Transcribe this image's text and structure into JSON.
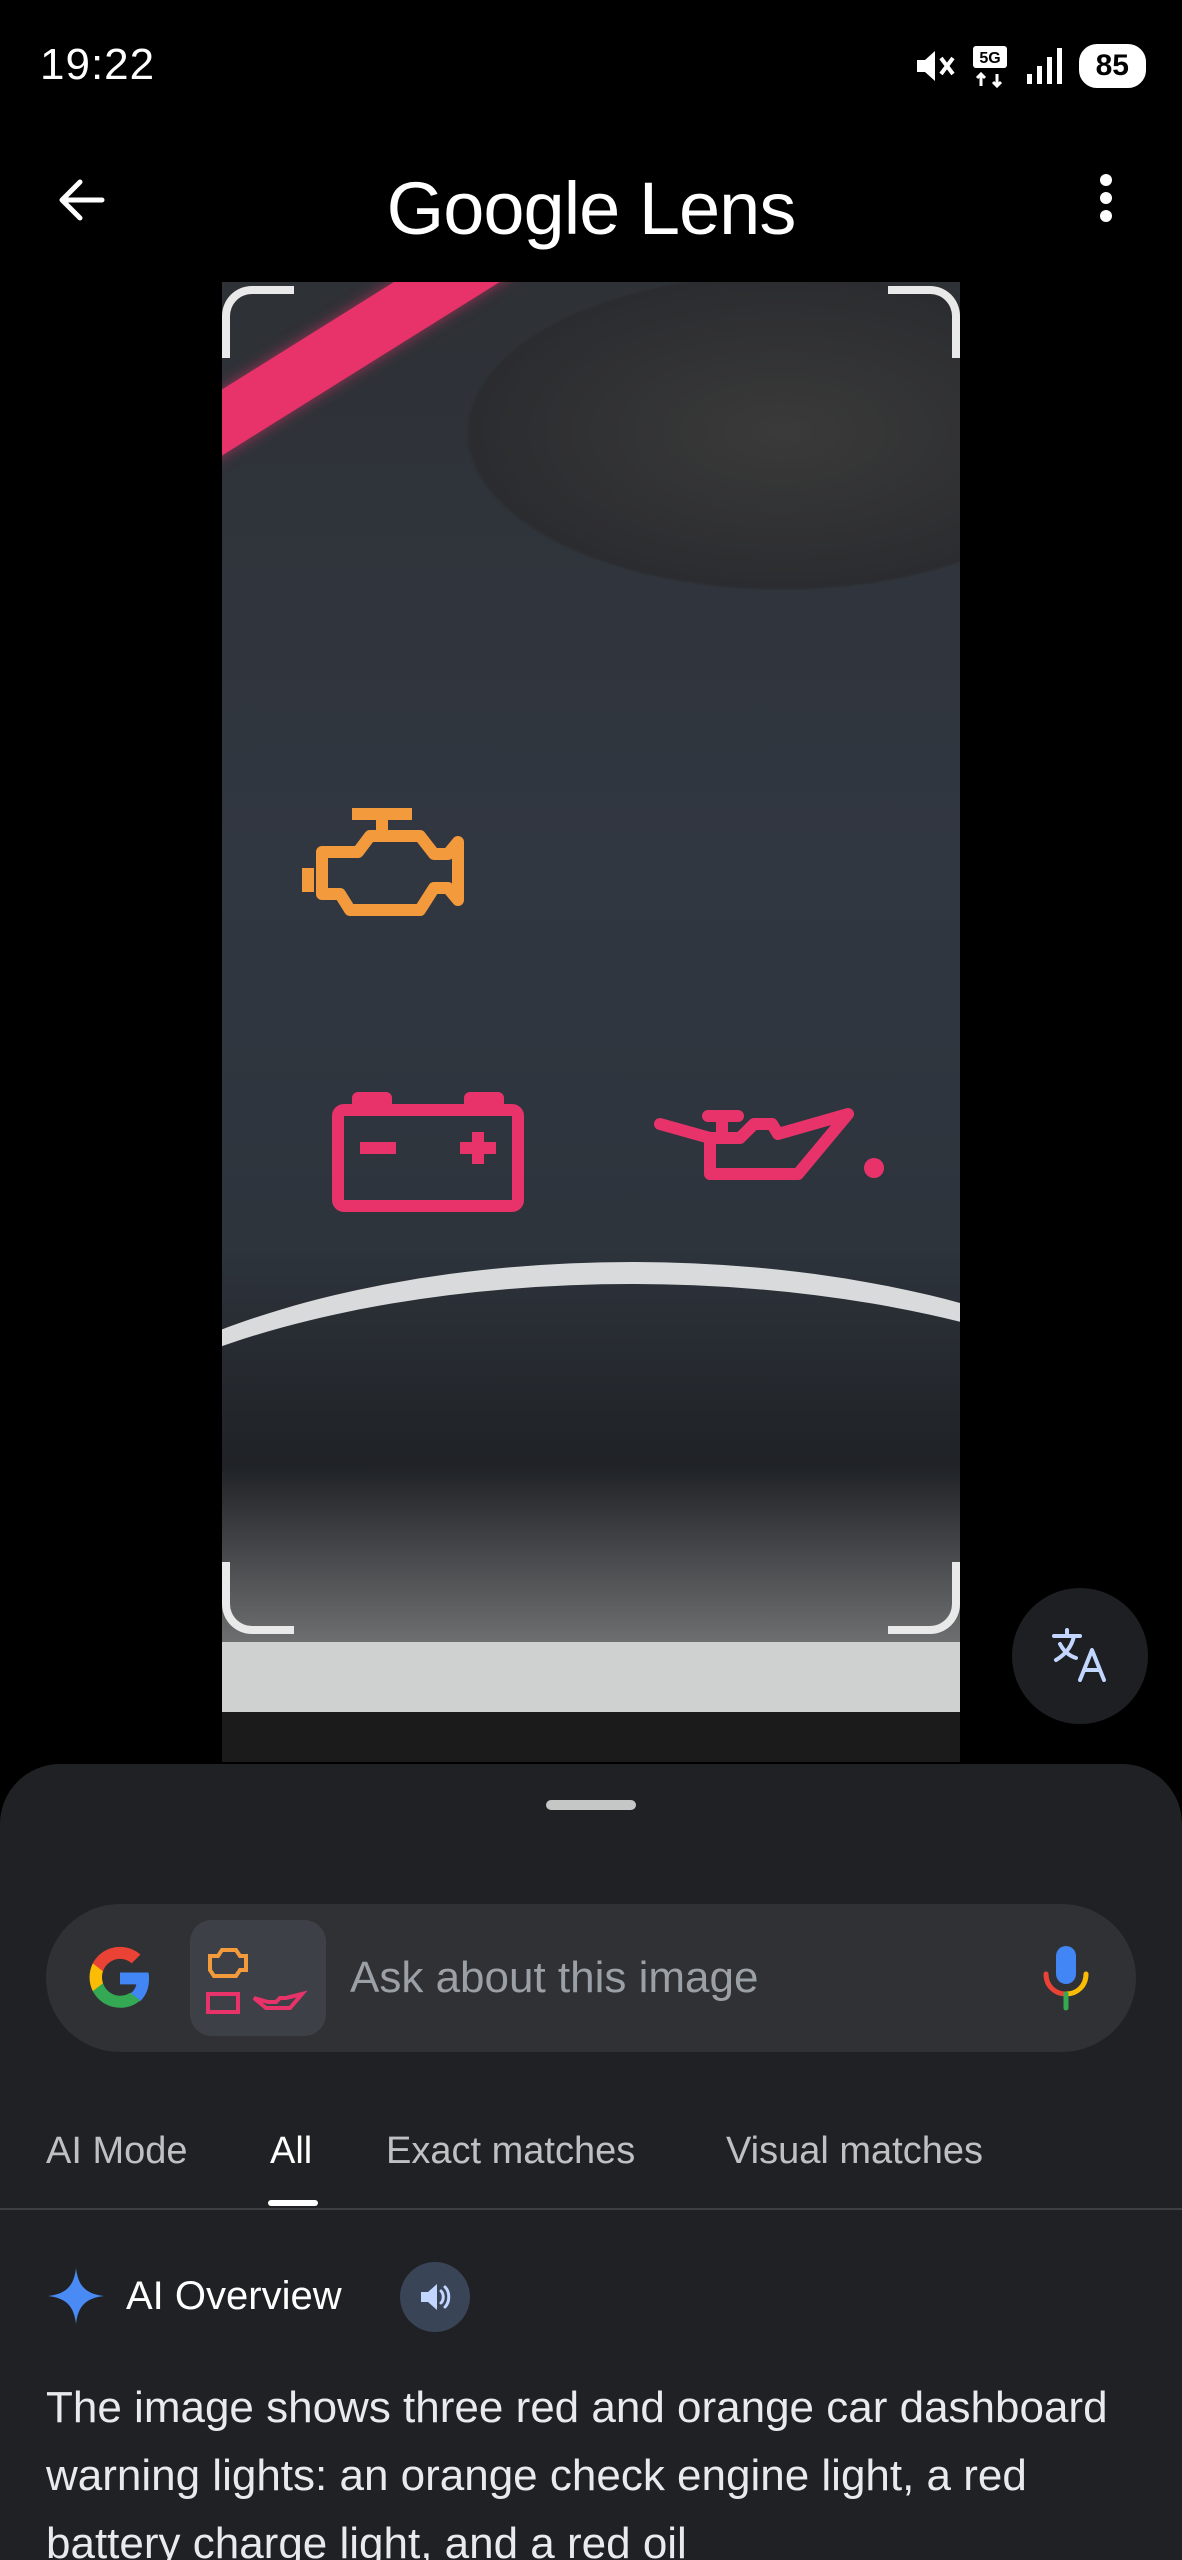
{
  "status_bar": {
    "time": "19:22",
    "battery": "85",
    "network": "5G"
  },
  "header": {
    "title": "Google Lens",
    "back_icon": "arrow-back-icon",
    "more_icon": "more-vert-icon"
  },
  "image": {
    "description_icons": [
      "check-engine-icon",
      "battery-icon",
      "oil-can-icon"
    ],
    "translate_icon": "translate-icon"
  },
  "search": {
    "placeholder": "Ask about this image",
    "mic_icon": "mic-icon"
  },
  "tabs": [
    {
      "label": "AI Mode",
      "active": false
    },
    {
      "label": "All",
      "active": true
    },
    {
      "label": "Exact matches",
      "active": false
    },
    {
      "label": "Visual matches",
      "active": false
    }
  ],
  "ai_overview": {
    "title": "AI Overview",
    "text": "The image shows three red and orange car dashboard warning lights: an orange check engine light, a red battery charge light, and a red oil"
  },
  "colors": {
    "background": "#000000",
    "sheet": "#202124",
    "search_box": "#303134",
    "warning_red": "#e8336a",
    "warning_orange": "#f39a3c",
    "sparkle_blue": "#4a8af4"
  }
}
